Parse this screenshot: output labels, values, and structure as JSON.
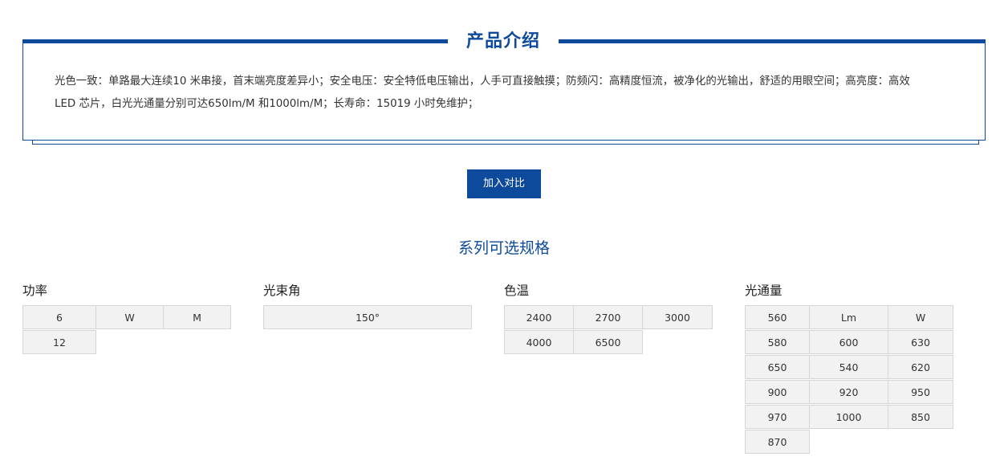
{
  "intro": {
    "title": "产品介绍",
    "line1": "光色一致：单路最大连续10 米串接，首末端亮度差异小；安全电压：安全特低电压输出，人手可直接触摸；防频闪：高精度恒流，被净化的光输出，舒适的用眼空间；高亮度：高效",
    "line2": "LED 芯片，白光光通量分别可达650lm/M 和1000lm/M；长寿命：15019 小时免维护；"
  },
  "compare_button": "加入对比",
  "series_title": "系列可选规格",
  "specs": {
    "power": {
      "label": "功率",
      "options": [
        "6",
        "W",
        "M",
        "12"
      ]
    },
    "beam_angle": {
      "label": "光束角",
      "options": [
        "150°"
      ]
    },
    "color_temp": {
      "label": "色温",
      "options": [
        "2400",
        "2700",
        "3000",
        "4000",
        "6500"
      ]
    },
    "luminous_flux": {
      "label": "光通量",
      "options": [
        "560",
        "Lm",
        "W",
        "580",
        "600",
        "630",
        "650",
        "540",
        "620",
        "900",
        "920",
        "950",
        "970",
        "1000",
        "850",
        "870"
      ]
    }
  }
}
